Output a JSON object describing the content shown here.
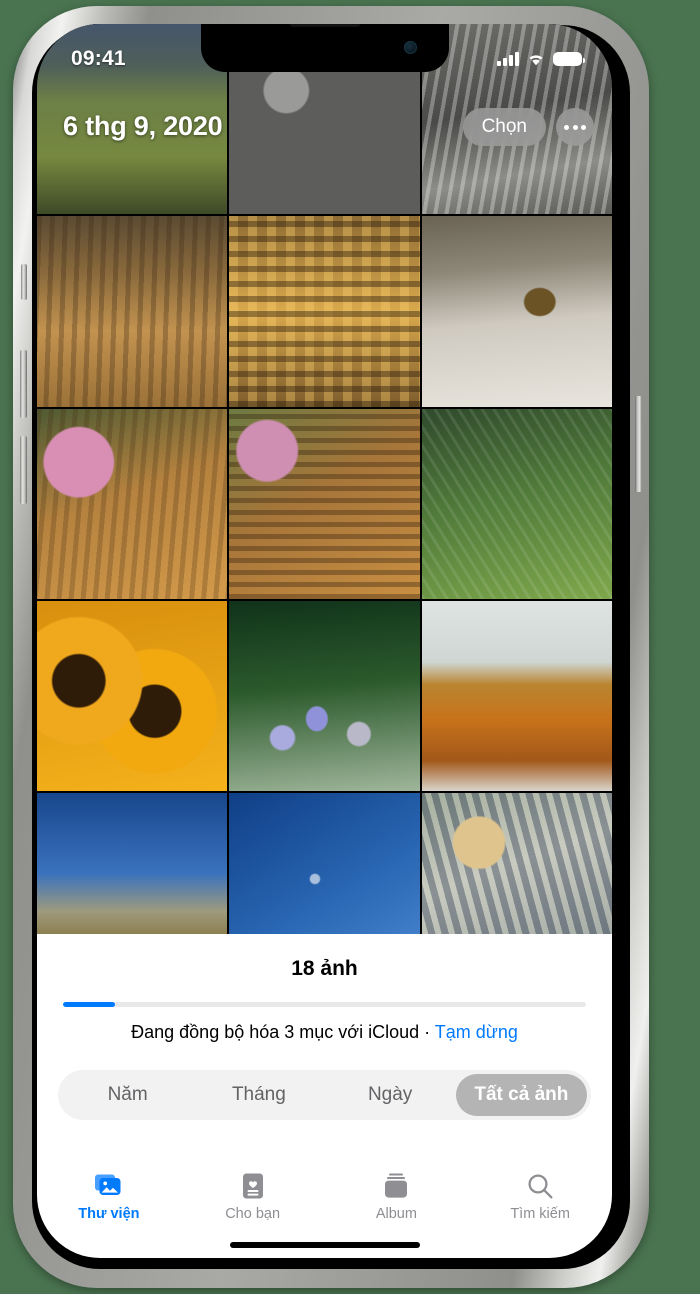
{
  "statusbar": {
    "time": "09:41",
    "signal_icon": "cellular-signal-icon",
    "wifi_icon": "wifi-icon",
    "battery_icon": "battery-full-icon"
  },
  "header": {
    "date_title": "6 thg 9, 2020",
    "choose_label": "Chọn",
    "more_icon": "more-ellipsis-icon"
  },
  "grid": {
    "columns": 3,
    "photos": [
      {
        "name": "field-landscape",
        "alt": "Cánh đồng cỏ xanh"
      },
      {
        "name": "rocky-stream",
        "alt": "Suối đá đen trắng"
      },
      {
        "name": "waterfall",
        "alt": "Thác nước"
      },
      {
        "name": "bees-on-hive-ledge",
        "alt": "Đàn ong trên mép tổ gỗ"
      },
      {
        "name": "bees-on-honeycomb",
        "alt": "Ong trên tầng sáp mật"
      },
      {
        "name": "single-bee-on-stone",
        "alt": "Một con ong trên đá"
      },
      {
        "name": "bees-pink-flowers",
        "alt": "Ong và hoa hồng phấn"
      },
      {
        "name": "bee-swarm-post",
        "alt": "Bầy ong bám cột gỗ"
      },
      {
        "name": "bee-on-green-fern",
        "alt": "Ong trên lá dương xỉ"
      },
      {
        "name": "sunflowers",
        "alt": "Hoa hướng dương"
      },
      {
        "name": "lavender-with-bee",
        "alt": "Hoa oải hương và ong bay"
      },
      {
        "name": "honey-jar",
        "alt": "Hũ mật ong trong suốt"
      },
      {
        "name": "wind-farm-desert",
        "alt": "Cánh đồng điện gió"
      },
      {
        "name": "wind-turbine-sky",
        "alt": "Tua bin gió trên nền trời"
      },
      {
        "name": "children-on-rocks",
        "alt": "Hai em bé chơi trên đá"
      }
    ]
  },
  "bottom": {
    "count_label": "18 ảnh",
    "progress_percent": 10,
    "sync_text": "Đang đồng bộ hóa 3 mục với iCloud · ",
    "pause_label": "Tạm dừng"
  },
  "segmented": {
    "options": [
      {
        "label": "Năm",
        "active": false
      },
      {
        "label": "Tháng",
        "active": false
      },
      {
        "label": "Ngày",
        "active": false
      },
      {
        "label": "Tất cả ảnh",
        "active": true
      }
    ]
  },
  "tabbar": {
    "tabs": [
      {
        "label": "Thư viện",
        "icon": "photos-library-icon",
        "active": true
      },
      {
        "label": "Cho bạn",
        "icon": "for-you-card-icon",
        "active": false
      },
      {
        "label": "Album",
        "icon": "albums-stack-icon",
        "active": false
      },
      {
        "label": "Tìm kiếm",
        "icon": "search-icon",
        "active": false
      }
    ]
  },
  "colors": {
    "accent": "#007aff",
    "inactive": "#8e8e93",
    "page_background": "#4a7450",
    "segment_selected": "#b4b4b4"
  }
}
